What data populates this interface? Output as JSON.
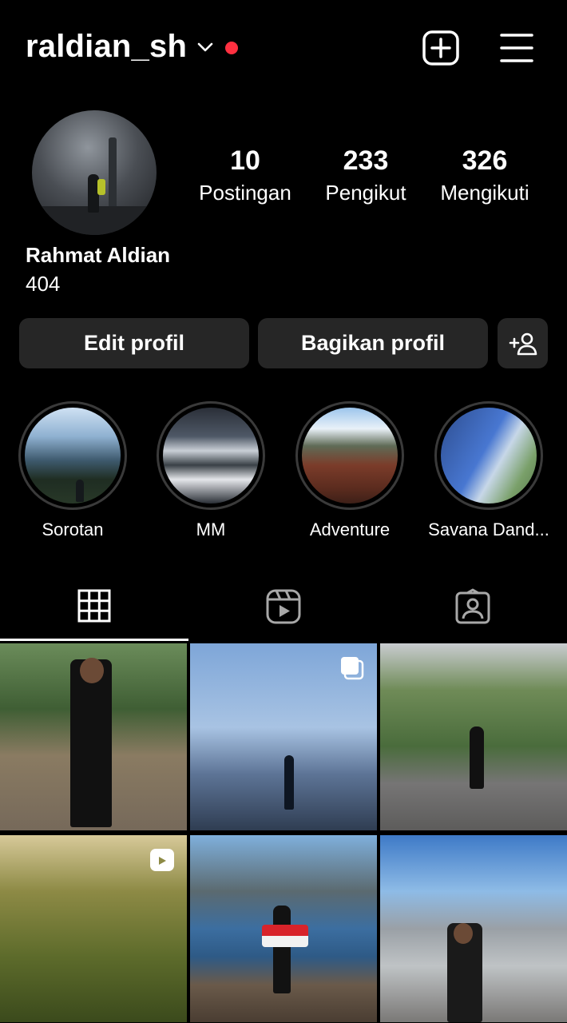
{
  "header": {
    "username": "raldian_sh",
    "icons": {
      "chevron": "chevron-down-icon",
      "notification": "red-dot",
      "add": "plus-square-icon",
      "menu": "hamburger-menu-icon"
    },
    "notification_color": "#ff3040"
  },
  "profile": {
    "full_name": "Rahmat Aldian",
    "bio": "404",
    "stats": [
      {
        "value": "10",
        "label": "Postingan"
      },
      {
        "value": "233",
        "label": "Pengikut"
      },
      {
        "value": "326",
        "label": "Mengikuti"
      }
    ]
  },
  "actions": {
    "edit_label": "Edit profil",
    "share_label": "Bagikan profil",
    "add_user_icon": "add-person-icon"
  },
  "highlights": [
    {
      "label": "Sorotan"
    },
    {
      "label": "MM"
    },
    {
      "label": "Adventure"
    },
    {
      "label": "Savana Dand..."
    }
  ],
  "tabs": [
    {
      "icon": "grid-icon",
      "active": true
    },
    {
      "icon": "reels-icon",
      "active": false
    },
    {
      "icon": "tagged-icon",
      "active": false
    }
  ],
  "posts": [
    {
      "type": "photo"
    },
    {
      "type": "carousel",
      "badge_icon": "carousel-icon"
    },
    {
      "type": "photo"
    },
    {
      "type": "reel",
      "badge_icon": "reel-icon"
    },
    {
      "type": "photo"
    },
    {
      "type": "photo"
    }
  ],
  "colors": {
    "background": "#000000",
    "button": "#262626",
    "text": "#ffffff"
  }
}
